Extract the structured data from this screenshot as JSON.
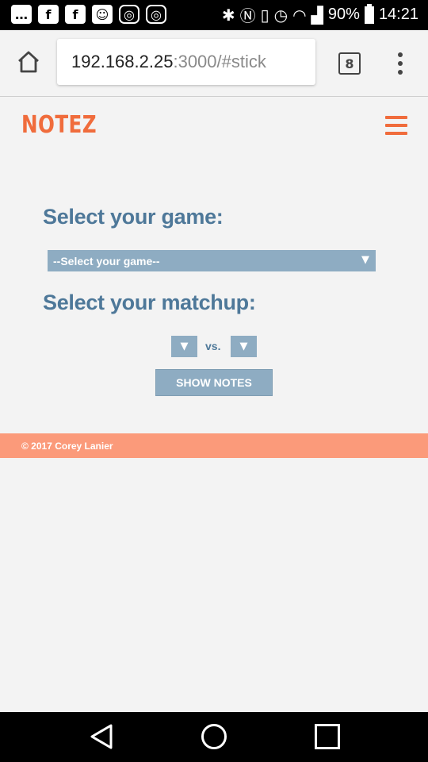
{
  "status_bar": {
    "battery_percent": "90%",
    "time": "14:21",
    "notification_icons": [
      "chat-icon",
      "facebook-icon",
      "facebook-icon",
      "discord-icon",
      "instagram-icon",
      "instagram-icon"
    ],
    "system_icons": [
      "bluetooth-icon",
      "nfc-icon",
      "vibrate-icon",
      "alarm-icon",
      "wifi-icon",
      "signal-icon",
      "battery-icon"
    ]
  },
  "browser": {
    "url_host": "192.168.2.25",
    "url_path": ":3000/#stick",
    "tab_count": "8"
  },
  "app": {
    "logo": "NOTEZ",
    "game_heading": "Select your game:",
    "game_select_value": "--Select your game--",
    "matchup_heading": "Select your matchup:",
    "vs_label": "vs.",
    "show_notes_label": "SHOW NOTES",
    "footer_text": "© 2017 Corey Lanier"
  },
  "colors": {
    "brand_orange": "#f06c3c",
    "heading_blue": "#4e7899",
    "control_blue": "#8eacc2",
    "footer_salmon": "#fb9a7a"
  }
}
